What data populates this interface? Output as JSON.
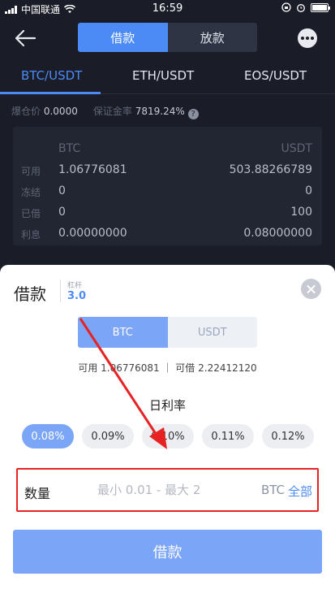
{
  "status_bar": {
    "carrier": "中国联通",
    "time": "16:59"
  },
  "nav": {
    "tabs": [
      {
        "label": "借款",
        "active": true
      },
      {
        "label": "放款",
        "active": false
      }
    ]
  },
  "pairs": [
    {
      "label": "BTC/USDT",
      "active": true
    },
    {
      "label": "ETH/USDT"
    },
    {
      "label": "EOS/USDT"
    }
  ],
  "info": {
    "liq_label": "爆仓价",
    "liq_value": "0.0000",
    "margin_label": "保证金率",
    "margin_value": "7819.24%"
  },
  "balance": {
    "headers": [
      "BTC",
      "USDT"
    ],
    "rows": [
      {
        "label": "可用",
        "btc": "1.06776081",
        "usdt": "503.88266789"
      },
      {
        "label": "冻结",
        "btc": "0",
        "usdt": "0"
      },
      {
        "label": "已借",
        "btc": "0",
        "usdt": "100"
      },
      {
        "label": "利息",
        "btc": "0.00000000",
        "usdt": "0.08000000"
      }
    ]
  },
  "sheet": {
    "title": "借款",
    "leverage_label": "杠杆",
    "leverage_value": "3.0",
    "coins": [
      {
        "label": "BTC",
        "active": true
      },
      {
        "label": "USDT",
        "active": false
      }
    ],
    "available_text": "可用 1.06776081 ｜ 可借 2.22412120",
    "rate_title": "日利率",
    "rates": [
      {
        "label": "0.08%",
        "active": true
      },
      {
        "label": "0.09%"
      },
      {
        "label": "0.10%"
      },
      {
        "label": "0.11%"
      },
      {
        "label": "0.12%"
      }
    ],
    "qty_label": "数量",
    "qty_placeholder": "最小 0.01 - 最大 2",
    "qty_unit": "BTC",
    "qty_all": "全部",
    "submit_label": "借款"
  },
  "colors": {
    "accent": "#4c8bf5",
    "highlight_box": "#e62222",
    "arrow": "#e62222"
  }
}
